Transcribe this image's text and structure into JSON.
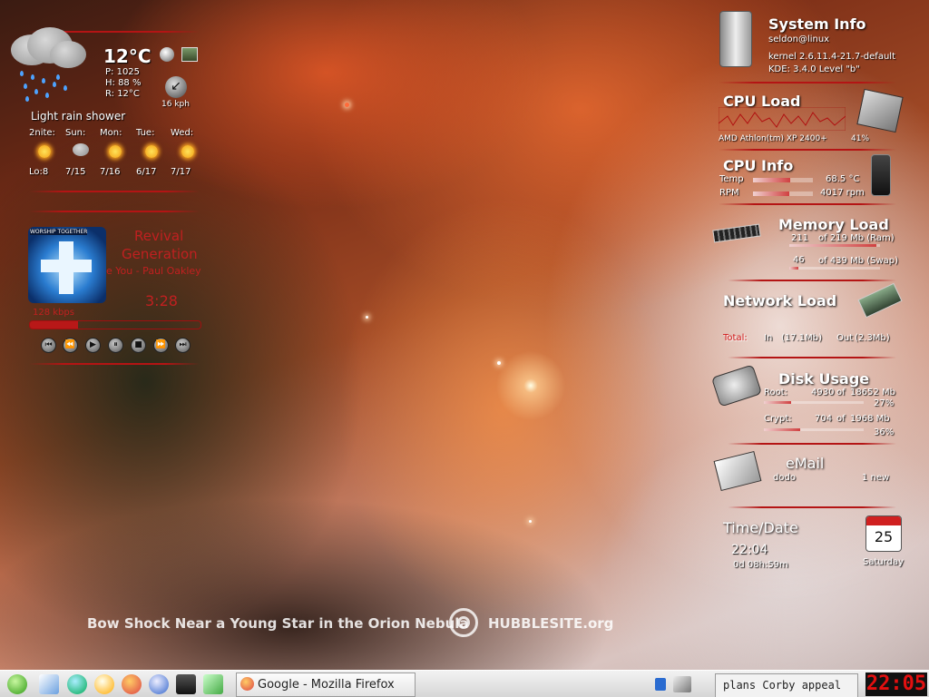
{
  "weather": {
    "temp": "12°C",
    "pressure": "P: 1025",
    "humidity": "H: 88 %",
    "rain_temp": "R: 12°C",
    "wind": "16 kph",
    "condition": "Light rain shower",
    "forecast": [
      {
        "day": "2nite:",
        "temp": "Lo:8"
      },
      {
        "day": "Sun:",
        "temp": "7/15"
      },
      {
        "day": "Mon:",
        "temp": "7/16"
      },
      {
        "day": "Tue:",
        "temp": "6/17"
      },
      {
        "day": "Wed:",
        "temp": "7/17"
      }
    ]
  },
  "player": {
    "album_art_text": "WORSHIP TOGETHER",
    "title_line1": "Revival",
    "title_line2": "Generation",
    "artist": "e You - Paul Oakley",
    "time": "3:28",
    "bitrate": "128 kbps",
    "progress": 0.28,
    "buttons": [
      "first",
      "rewind",
      "play",
      "pause",
      "stop",
      "forward",
      "last"
    ]
  },
  "sysinfo": {
    "title": "System Info",
    "user": "seldon@linux",
    "kernel": "kernel 2.6.11.4-21.7-default",
    "kde": "KDE: 3.4.0 Level \"b\""
  },
  "cpuload": {
    "title": "CPU Load",
    "cpu": "AMD Athlon(tm) XP 2400+",
    "percent": "41%"
  },
  "cpuinfo": {
    "title": "CPU Info",
    "temp_label": "Temp",
    "temp_value": "68.5 °C",
    "temp_fill": 0.62,
    "rpm_label": "RPM",
    "rpm_value": "4017 rpm",
    "rpm_fill": 0.6
  },
  "memory": {
    "title": "Memory Load",
    "ram_used": "211",
    "ram_text": "of 219 Mb (Ram)",
    "ram_fill": 0.96,
    "swap_used": "46",
    "swap_text": "of 439 Mb (Swap)",
    "swap_fill": 0.1
  },
  "network": {
    "title": "Network Load",
    "total": "Total:",
    "in": "In",
    "in_value": "(17.1Mb)",
    "out": "Out",
    "out_value": "(2.3Mb)"
  },
  "disk": {
    "title": "Disk Usage",
    "root_label": "Root:",
    "root_used": "4930",
    "root_of": "of",
    "root_total": "18652 Mb",
    "root_pct": "27%",
    "root_fill": 0.27,
    "crypt_label": "Crypt:",
    "crypt_used": "704",
    "crypt_of": "of",
    "crypt_total": "1968 Mb",
    "crypt_pct": "36%",
    "crypt_fill": 0.36
  },
  "email": {
    "title": "eMail",
    "account": "dodo",
    "count": "1 new"
  },
  "timedate": {
    "title": "Time/Date",
    "time": "22:04",
    "uptime": "0d 08h:59m",
    "day": "25",
    "weekday": "Saturday"
  },
  "wallpaper": {
    "caption": "Bow Shock Near a Young Star in the Orion Nebula",
    "brand": "HUBBLESITE.org"
  },
  "taskbar": {
    "task": "Google - Mozilla Firefox",
    "ticker": "plans Corby appeal",
    "clock": "22:05"
  }
}
